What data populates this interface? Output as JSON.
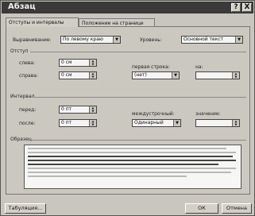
{
  "window": {
    "title": "Абзац"
  },
  "title_buttons": {
    "help": "?",
    "close": "X"
  },
  "tabs": [
    {
      "label": "Отступы и интервалы"
    },
    {
      "label": "Положение на странице"
    }
  ],
  "general": {
    "alignment_label": "Выравнивание:",
    "alignment_value": "По левому краю",
    "level_label": "Уровень:",
    "level_value": "Основной текст"
  },
  "indent": {
    "section_label": "Отступ",
    "left_label": "слева:",
    "left_value": "0 см",
    "right_label": "справа:",
    "right_value": "0 см",
    "first_line_label": "первая строка:",
    "first_line_value": "(нет)",
    "by_label": "на:",
    "by_value": ""
  },
  "spacing": {
    "section_label": "Интервал",
    "before_label": "перед:",
    "before_value": "0 пт",
    "after_label": "после:",
    "after_value": "0 пт",
    "line_spacing_label": "междустрочный:",
    "line_spacing_value": "Одинарный",
    "value_label": "значение:",
    "value_value": ""
  },
  "preview": {
    "label": "Образец"
  },
  "buttons": {
    "tabs": "Табуляция...",
    "ok": "ОК",
    "cancel": "Отмена"
  },
  "icons": {
    "dropdown": "▼",
    "spin_up": "▲",
    "spin_down": "▼"
  }
}
